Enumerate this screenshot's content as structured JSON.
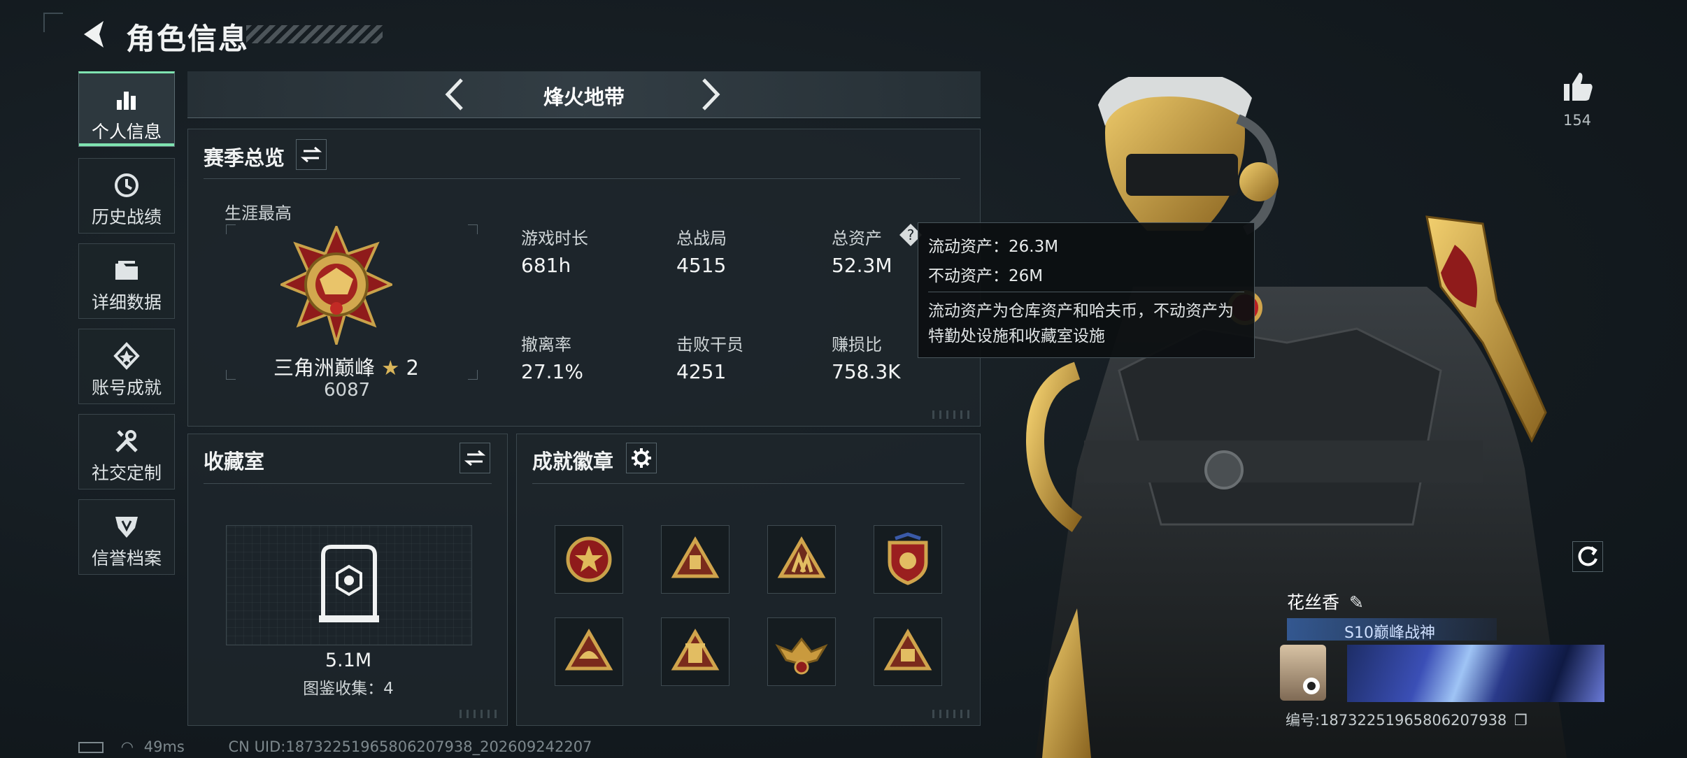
{
  "header": {
    "title": "角色信息"
  },
  "sidebar": {
    "items": [
      {
        "label": "个人信息",
        "icon": "bar-chart-icon",
        "active": true
      },
      {
        "label": "历史战绩",
        "icon": "clock-icon",
        "active": false
      },
      {
        "label": "详细数据",
        "icon": "folder-icon",
        "active": false
      },
      {
        "label": "账号成就",
        "icon": "achievement-icon",
        "active": false
      },
      {
        "label": "社交定制",
        "icon": "tools-icon",
        "active": false
      },
      {
        "label": "信誉档案",
        "icon": "shield-icon",
        "active": false
      }
    ]
  },
  "mode_tab": {
    "label": "烽火地带"
  },
  "season": {
    "title": "赛季总览",
    "career_best_label": "生涯最高",
    "rank_name": "三角洲巅峰",
    "rank_stars": "2",
    "rank_score": "6087",
    "stats": [
      {
        "label": "游戏时长",
        "value": "681h"
      },
      {
        "label": "总战局",
        "value": "4515"
      },
      {
        "label": "总资产",
        "value": "52.3M"
      },
      {
        "label": "撤离率",
        "value": "27.1%"
      },
      {
        "label": "击败干员",
        "value": "4251"
      },
      {
        "label": "赚损比",
        "value": "758.3K"
      }
    ]
  },
  "tooltip": {
    "liquid": "流动资产：26.3M",
    "fixed": "不动资产：26M",
    "desc": "流动资产为仓库资产和哈夫币，不动资产为特勤处设施和收藏室设施"
  },
  "collection": {
    "title": "收藏室",
    "value": "5.1M",
    "count_label": "图鉴收集：4"
  },
  "achievements": {
    "title": "成就徽章"
  },
  "likes": {
    "count": "154"
  },
  "player": {
    "name": "花丝香",
    "title_badge": "S10巅峰战神",
    "id_label": "编号:18732251965806207938"
  },
  "status": {
    "ping": "49ms",
    "uid": "CN UID:18732251965806207938_202609242207"
  },
  "colors": {
    "accent": "#7fe3b0",
    "gold": "#c9a24a",
    "panel": "#1e262b"
  }
}
